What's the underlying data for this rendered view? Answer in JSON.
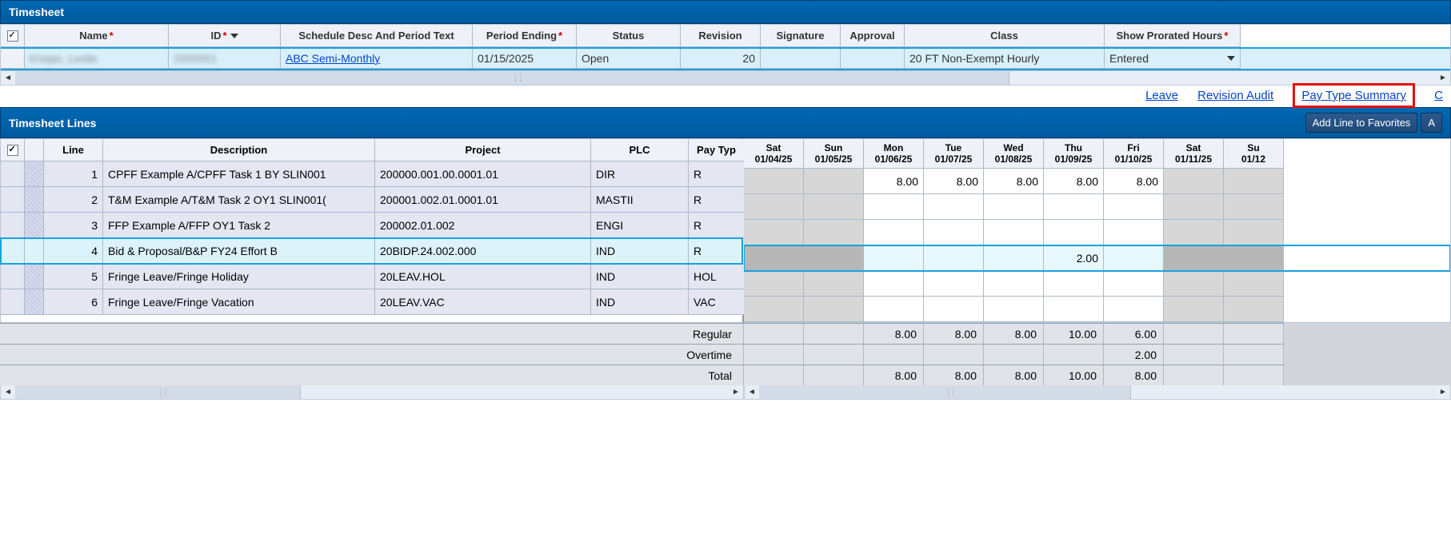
{
  "timesheet_panel_title": "Timesheet",
  "header": {
    "cols": {
      "name": "Name",
      "id": "ID",
      "sched": "Schedule Desc And Period Text",
      "period_ending": "Period Ending",
      "status": "Status",
      "revision": "Revision",
      "signature": "Signature",
      "approval": "Approval",
      "class": "Class",
      "show_prorated": "Show Prorated Hours"
    },
    "row": {
      "name": "Knope, Leslie",
      "id": "2000001",
      "schedule": "ABC Semi-Monthly",
      "period_ending": "01/15/2025",
      "status": "Open",
      "revision": "20",
      "signature": "",
      "approval": "",
      "class": "20 FT Non-Exempt Hourly",
      "show_prorated": "Entered"
    }
  },
  "link_bar": {
    "leave": "Leave",
    "revision_audit": "Revision Audit",
    "pay_type_summary": "Pay Type Summary",
    "c_partial": "C"
  },
  "lines_panel_title": "Timesheet Lines",
  "buttons": {
    "add_fav": "Add Line to Favorites",
    "a_partial": "A"
  },
  "lines_header": {
    "line": "Line",
    "description": "Description",
    "project": "Project",
    "plc": "PLC",
    "pay_type": "Pay Typ"
  },
  "days": [
    {
      "dow": "Sat",
      "date": "01/04/25",
      "weekend": true
    },
    {
      "dow": "Sun",
      "date": "01/05/25",
      "weekend": true
    },
    {
      "dow": "Mon",
      "date": "01/06/25",
      "weekend": false
    },
    {
      "dow": "Tue",
      "date": "01/07/25",
      "weekend": false
    },
    {
      "dow": "Wed",
      "date": "01/08/25",
      "weekend": false
    },
    {
      "dow": "Thu",
      "date": "01/09/25",
      "weekend": false
    },
    {
      "dow": "Fri",
      "date": "01/10/25",
      "weekend": false
    },
    {
      "dow": "Sat",
      "date": "01/11/25",
      "weekend": true
    },
    {
      "dow": "Su",
      "date": "01/12",
      "weekend": true
    }
  ],
  "lines": [
    {
      "n": "1",
      "desc": "CPFF Example A/CPFF Task 1 BY SLIN001",
      "project": "200000.001.00.0001.01",
      "plc": "DIR",
      "pay": "R",
      "hours": [
        "",
        "",
        "8.00",
        "8.00",
        "8.00",
        "8.00",
        "8.00",
        "",
        ""
      ],
      "selected": false
    },
    {
      "n": "2",
      "desc": "T&M Example A/T&M Task 2 OY1 SLIN001(",
      "project": "200001.002.01.0001.01",
      "plc": "MASTII",
      "pay": "R",
      "hours": [
        "",
        "",
        "",
        "",
        "",
        "",
        "",
        "",
        ""
      ],
      "selected": false
    },
    {
      "n": "3",
      "desc": "FFP Example A/FFP OY1 Task 2",
      "project": "200002.01.002",
      "plc": "ENGI",
      "pay": "R",
      "hours": [
        "",
        "",
        "",
        "",
        "",
        "",
        "",
        "",
        ""
      ],
      "selected": false
    },
    {
      "n": "4",
      "desc": "Bid & Proposal/B&P FY24 Effort B",
      "project": "20BIDP.24.002.000",
      "plc": "IND",
      "pay": "R",
      "hours": [
        "",
        "",
        "",
        "",
        "",
        "2.00",
        "",
        "",
        ""
      ],
      "selected": true
    },
    {
      "n": "5",
      "desc": "Fringe Leave/Fringe Holiday",
      "project": "20LEAV.HOL",
      "plc": "IND",
      "pay": "HOL",
      "hours": [
        "",
        "",
        "",
        "",
        "",
        "",
        "",
        "",
        ""
      ],
      "selected": false
    },
    {
      "n": "6",
      "desc": "Fringe Leave/Fringe Vacation",
      "project": "20LEAV.VAC",
      "plc": "IND",
      "pay": "VAC",
      "hours": [
        "",
        "",
        "",
        "",
        "",
        "",
        "",
        "",
        ""
      ],
      "selected": false
    }
  ],
  "totals": {
    "labels": {
      "regular": "Regular",
      "overtime": "Overtime",
      "total": "Total"
    },
    "regular": [
      "",
      "",
      "8.00",
      "8.00",
      "8.00",
      "10.00",
      "6.00",
      "",
      ""
    ],
    "overtime": [
      "",
      "",
      "",
      "",
      "",
      "",
      "2.00",
      "",
      ""
    ],
    "total": [
      "",
      "",
      "8.00",
      "8.00",
      "8.00",
      "10.00",
      "8.00",
      "",
      ""
    ]
  }
}
